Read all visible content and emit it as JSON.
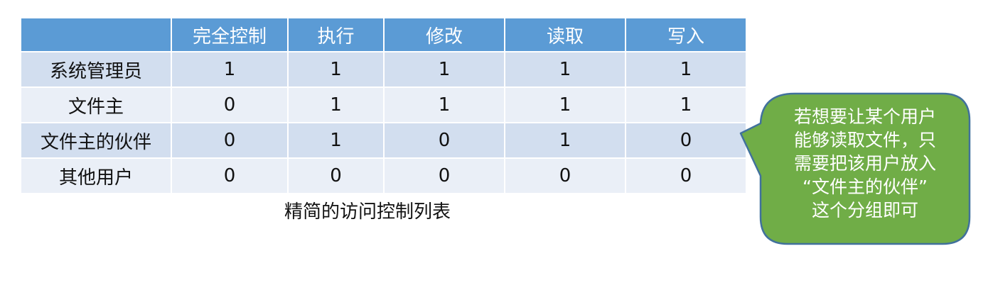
{
  "table": {
    "headers": [
      "",
      "完全控制",
      "执行",
      "修改",
      "读取",
      "写入"
    ],
    "rows": [
      {
        "label": "系统管理员",
        "values": [
          "1",
          "1",
          "1",
          "1",
          "1"
        ]
      },
      {
        "label": "文件主",
        "values": [
          "0",
          "1",
          "1",
          "1",
          "1"
        ]
      },
      {
        "label": "文件主的伙伴",
        "values": [
          "0",
          "1",
          "0",
          "1",
          "0"
        ]
      },
      {
        "label": "其他用户",
        "values": [
          "0",
          "0",
          "0",
          "0",
          "0"
        ]
      }
    ]
  },
  "caption": "精简的访问控制列表",
  "callout": {
    "lines": [
      "若想要让某个用户",
      "能够读取文件，只",
      "需要把该用户放入",
      "“文件主的伙伴”",
      "这个分组即可"
    ]
  },
  "colors": {
    "header_bg": "#5b9bd5",
    "row_odd": "#d2deef",
    "row_even": "#eaeff7",
    "callout_fill": "#70ad47",
    "callout_border": "#41719c"
  }
}
